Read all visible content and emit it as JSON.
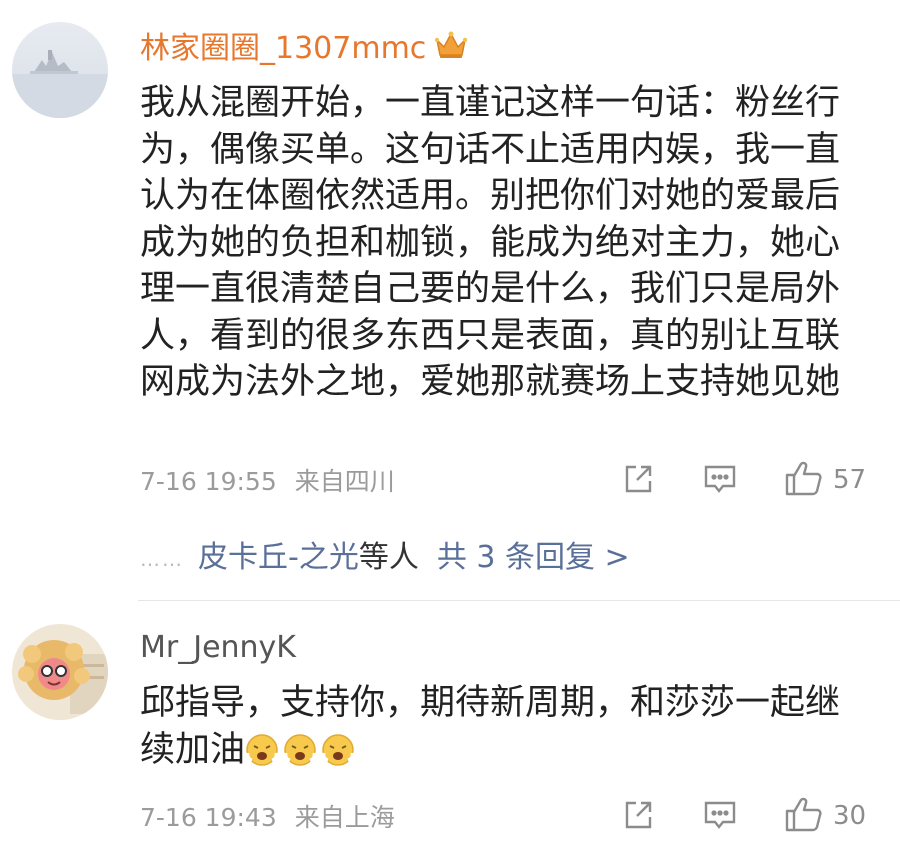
{
  "comments": [
    {
      "username": "林家圈圈_1307mmc",
      "content": "我从混圈开始，一直谨记这样一句话：粉丝行为，偶像买单。这句话不止适用内娱，我一直认为在体圈依然适用。别把你们对她的爱最后成为她的负担和枷锁，能成为绝对主力，她心理一直很清楚自己要的是什么，我们只是局外人，看到的很多东西只是表面，真的别让互联网成为法外之地，爱她那就赛场上支持她见她",
      "time": "7-16 19:55",
      "location": "来自四川",
      "likes": "57",
      "replies": {
        "dots": "……",
        "names": "皮卡丘-之光",
        "suffix": "等人",
        "count": "共 3 条回复 >"
      }
    },
    {
      "username": "Mr_JennyK",
      "content": "邱指导，支持你，期待新周期，和莎莎一起继续加油",
      "time": "7-16 19:43",
      "location": "来自上海",
      "likes": "30"
    }
  ],
  "colors": {
    "username_highlight": "#e8772e",
    "username_normal": "#555555",
    "reply_link": "#5a6f99",
    "meta": "#9b9b9b"
  },
  "icons": [
    "crown-badge-icon",
    "share-icon",
    "comment-icon",
    "like-icon",
    "emoji-icon"
  ]
}
